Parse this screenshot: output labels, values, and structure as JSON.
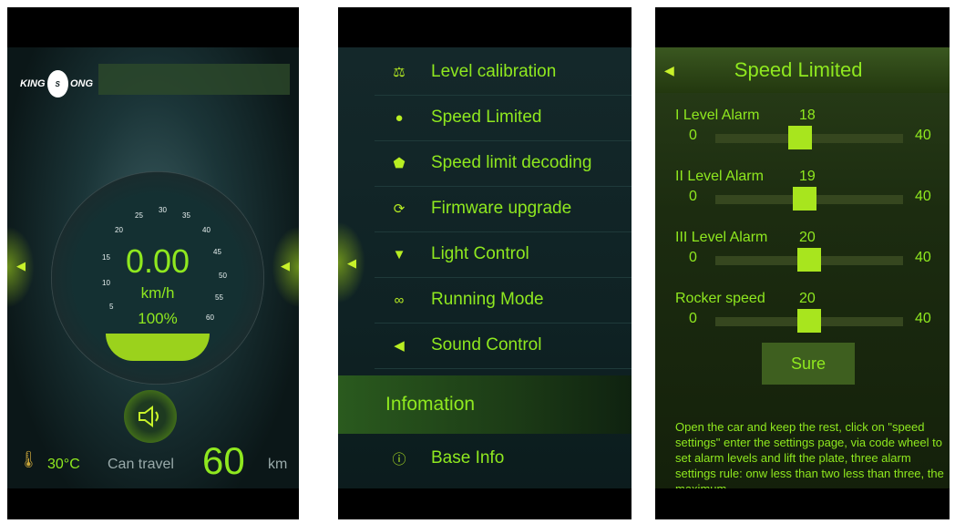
{
  "screen1": {
    "logo": {
      "left": "KING",
      "ring": "S",
      "right": "ONG"
    },
    "speed": "0.00",
    "unit": "km/h",
    "battery_pct": "100%",
    "ticks": [
      "5",
      "10",
      "15",
      "20",
      "25",
      "30",
      "35",
      "40",
      "45",
      "50",
      "55",
      "60"
    ],
    "temp": "30°C",
    "can_travel_label": "Can travel",
    "distance": "60",
    "distance_unit": "km",
    "arrow_left": "◀",
    "arrow_right": "▶"
  },
  "screen2": {
    "items": [
      {
        "label": "Level calibration",
        "icon": "scale-icon"
      },
      {
        "label": "Speed Limited",
        "icon": "speed-icon"
      },
      {
        "label": "Speed limit decoding",
        "icon": "shield-icon"
      },
      {
        "label": "Firmware upgrade",
        "icon": "refresh-icon"
      },
      {
        "label": "Light Control",
        "icon": "lamp-icon"
      },
      {
        "label": "Running Mode",
        "icon": "bike-icon"
      },
      {
        "label": "Sound Control",
        "icon": "speaker-icon"
      }
    ],
    "section_header": "Infomation",
    "base_info": "Base Info",
    "arrow_left": "◀"
  },
  "screen3": {
    "title": "Speed Limited",
    "back": "◀",
    "sliders": [
      {
        "label": "I Level Alarm",
        "value": 18,
        "min": "0",
        "max": "40"
      },
      {
        "label": "II Level Alarm",
        "value": 19,
        "min": "0",
        "max": "40"
      },
      {
        "label": "III Level Alarm",
        "value": 20,
        "min": "0",
        "max": "40"
      },
      {
        "label": "Rocker speed",
        "value": 20,
        "min": "0",
        "max": "40"
      }
    ],
    "sure_button": "Sure",
    "help_text": "Open the car and keep the rest, click on \"speed settings\" enter the settings page, via code wheel to set alarm levels and lift the plate, three alarm settings rule: onw less than two less than three, the maximum"
  },
  "colors": {
    "accent": "#8fe81f",
    "bg": "#0d1a1c"
  }
}
